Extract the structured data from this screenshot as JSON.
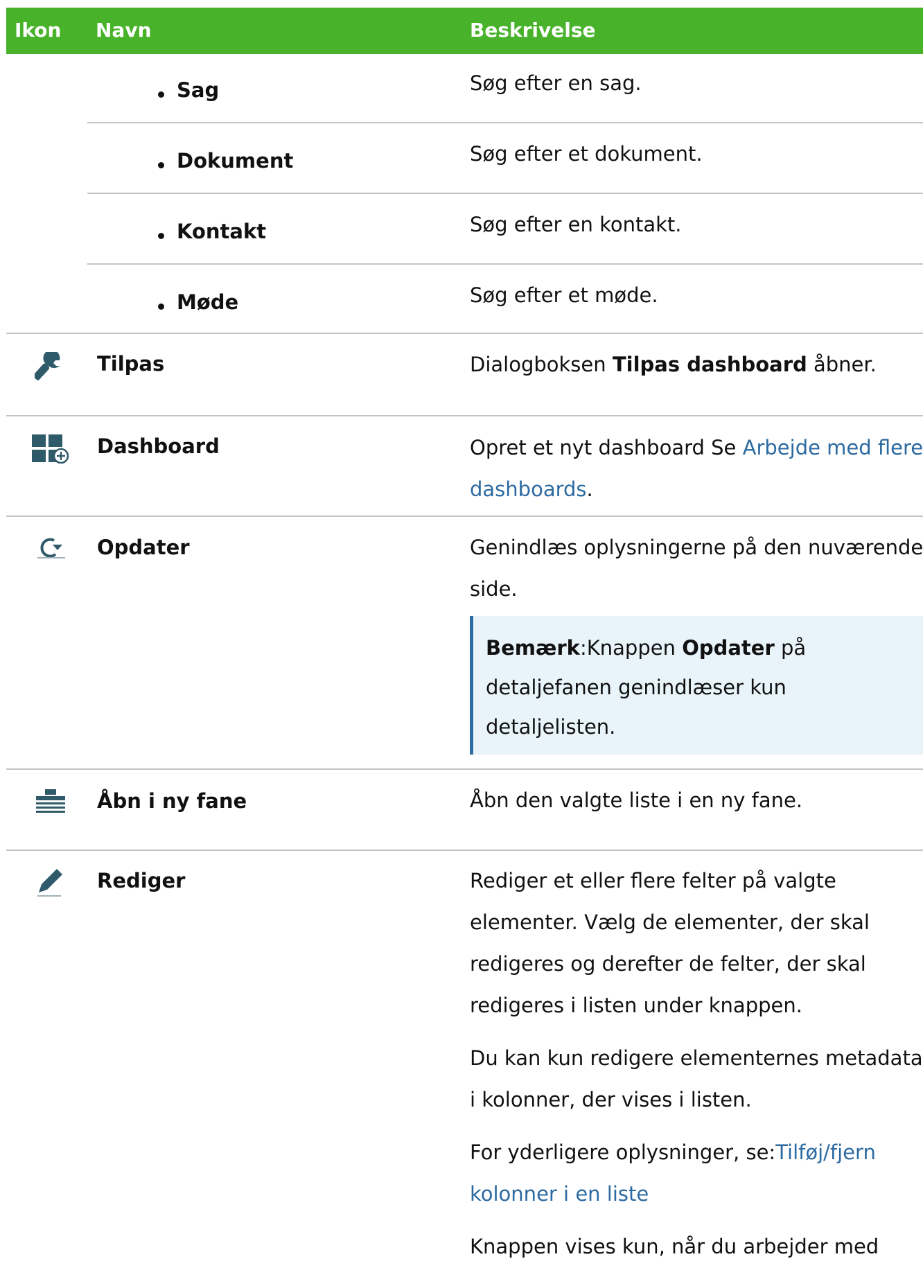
{
  "header": {
    "col_icon": "Ikon",
    "col_name": "Navn",
    "col_desc": "Beskrivelse"
  },
  "search_rows": [
    {
      "name": "Sag",
      "desc": "Søg efter en sag."
    },
    {
      "name": "Dokument",
      "desc": "Søg efter et dokument."
    },
    {
      "name": "Kontakt",
      "desc": "Søg efter en kontakt."
    },
    {
      "name": "Møde",
      "desc": "Søg efter et møde."
    }
  ],
  "tilpas": {
    "icon": "wrench-icon",
    "name": "Tilpas",
    "desc_pre": "Dialogboksen ",
    "desc_bold": "Tilpas dashboard",
    "desc_post": " åbner."
  },
  "dashboard": {
    "icon": "dashboard-add-icon",
    "name": "Dashboard",
    "desc_pre": "Opret et nyt dashboard Se ",
    "link_line1": "Arbejde med flere",
    "link_line2": "dashboards",
    "desc_post": "."
  },
  "opdater": {
    "icon": "refresh-icon",
    "name": "Opdater",
    "desc_line1": "Genindlæs oplysningerne på den nuværende",
    "desc_line2": "side.",
    "note": {
      "label": "Bemærk",
      "sep": ":",
      "pre": "Knappen ",
      "bold": "Opdater",
      "post": " på",
      "line2": "detaljefanen genindlæser kun",
      "line3": "detaljelisten."
    }
  },
  "aabn": {
    "icon": "open-new-tab-icon",
    "name": "Åbn i ny fane",
    "desc": "Åbn den valgte liste i en ny fane."
  },
  "rediger": {
    "icon": "pencil-icon",
    "name": "Rediger",
    "p1": [
      "Rediger et eller flere felter på valgte",
      "elementer. Vælg de elementer, der skal",
      "redigeres og derefter de felter, der skal",
      "redigeres i listen under knappen."
    ],
    "p2": [
      "Du kan kun redigere elementernes metadata",
      "i kolonner, der vises i listen."
    ],
    "p3_pre": "For yderligere oplysninger, se:",
    "p3_link1": "Tilføj/fjern",
    "p3_link2": "kolonner i en liste",
    "p4": "Knappen vises kun, når du arbejder med"
  },
  "colors": {
    "header_bg": "#48b32a",
    "link": "#2c6aa1",
    "note_bg": "#e9f3fa",
    "note_border": "#2e6da4",
    "divider": "#c4c4c4"
  }
}
